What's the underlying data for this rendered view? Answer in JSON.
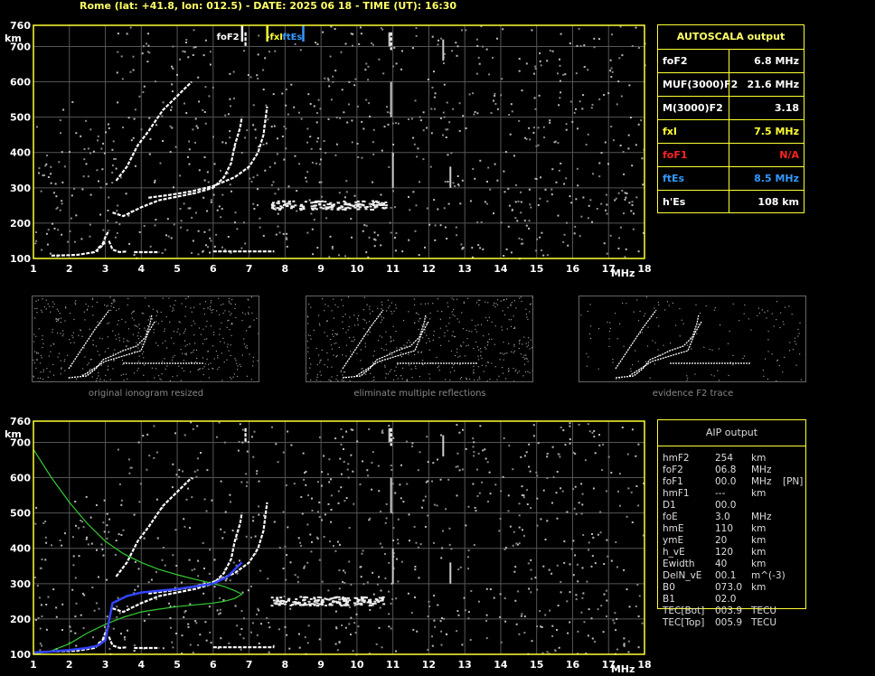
{
  "header": "Rome (lat: +41.8, lon: 012.5) - DATE: 2025 06 18 - TIME (UT): 16:30",
  "axes": {
    "y_ticks": [
      "760",
      "700",
      "600",
      "500",
      "400",
      "300",
      "200",
      "100"
    ],
    "y_unit": "km",
    "x_ticks": [
      "1",
      "2",
      "3",
      "4",
      "5",
      "6",
      "7",
      "8",
      "9",
      "10",
      "11",
      "12",
      "13",
      "14",
      "15",
      "16",
      "17",
      "18"
    ],
    "x_unit": "MHz"
  },
  "markers": {
    "foF2": "foF2",
    "fxI": "fxI",
    "ftEs": "ftEs",
    "foF2_color": "#ffffff",
    "fxI_color": "#ffff33",
    "ftEs_color": "#3399ff"
  },
  "autoscala": {
    "title": "AUTOSCALA output",
    "rows": [
      {
        "label": "foF2",
        "value": "6.8 MHz",
        "color": "#ffffff"
      },
      {
        "label": "MUF(3000)F2",
        "value": "21.6 MHz",
        "color": "#ffffff"
      },
      {
        "label": "M(3000)F2",
        "value": "3.18",
        "color": "#ffffff"
      },
      {
        "label": "fxI",
        "value": "7.5 MHz",
        "color": "#ffff33"
      },
      {
        "label": "foF1",
        "value": "N/A",
        "color": "#ff2222"
      },
      {
        "label": "ftEs",
        "value": "8.5 MHz",
        "color": "#3399ff"
      },
      {
        "label": "h'Es",
        "value": "108    km",
        "color": "#ffffff"
      }
    ]
  },
  "thumbnails": [
    {
      "caption": "original ionogram resized"
    },
    {
      "caption": "eliminate multiple reflections"
    },
    {
      "caption": "evidence F2 trace"
    }
  ],
  "aip": {
    "title": "AIP output",
    "rows": [
      [
        "hmF2",
        "254",
        "km",
        ""
      ],
      [
        "foF2",
        "06.8",
        "MHz",
        ""
      ],
      [
        "foF1",
        "00.0",
        "MHz",
        "[PN]"
      ],
      [
        "hmF1",
        "---",
        "km",
        ""
      ],
      [
        "D1",
        "00.0",
        "",
        ""
      ],
      [
        "foE",
        "3.0",
        "MHz",
        ""
      ],
      [
        "hmE",
        "110",
        "km",
        ""
      ],
      [
        "ymE",
        "20",
        "km",
        ""
      ],
      [
        "h_vE",
        "120",
        "km",
        ""
      ],
      [
        "Ewidth",
        "40",
        "km",
        ""
      ],
      [
        "DelN_vE",
        "00.1",
        "m^(-3)",
        ""
      ],
      [
        "B0",
        "073.0",
        "km",
        ""
      ],
      [
        "B1",
        "02.0",
        "",
        ""
      ],
      [
        "TEC[Bot]",
        "003.9",
        "TECU",
        ""
      ],
      [
        "TEC[Top]",
        "005.9",
        "TECU",
        ""
      ]
    ]
  },
  "chart_data": [
    {
      "type": "scatter",
      "title": "",
      "xlabel": "MHz",
      "ylabel": "km",
      "xlim": [
        1,
        18
      ],
      "ylim": [
        100,
        760
      ],
      "grid": true,
      "series": [
        {
          "name": "foF2",
          "color": "#ffffff",
          "x": [
            3.6,
            3.8,
            4.0,
            4.5,
            5.0,
            5.5,
            6.0,
            6.3,
            6.5,
            6.6,
            6.7,
            6.8
          ],
          "values": [
            255,
            262,
            270,
            278,
            286,
            300,
            325,
            350,
            380,
            420,
            470,
            500
          ]
        },
        {
          "name": "fxI",
          "color": "#ffffff",
          "x": [
            4.2,
            4.8,
            5.4,
            6.0,
            6.6,
            7.0,
            7.2,
            7.35,
            7.45,
            7.5
          ],
          "values": [
            270,
            278,
            285,
            300,
            320,
            350,
            390,
            440,
            500,
            550
          ]
        },
        {
          "name": "ftEs",
          "color": "#ffffff",
          "x": [
            7.5,
            8.0,
            8.5,
            9.0,
            9.5,
            10.0,
            10.5,
            10.7
          ],
          "values": [
            245,
            250,
            255,
            250,
            255,
            250,
            255,
            250
          ]
        }
      ]
    },
    {
      "type": "line",
      "title": "",
      "xlabel": "MHz",
      "ylabel": "km",
      "xlim": [
        1,
        18
      ],
      "ylim": [
        100,
        760
      ],
      "grid": true,
      "series": [
        {
          "name": "hmF2",
          "color": "#33cc33",
          "x": [
            1.0,
            1.5,
            2.0,
            2.5,
            3.0,
            3.5,
            4.0,
            4.5,
            5.0,
            5.5,
            6.0,
            6.3,
            6.6,
            6.8,
            6.6,
            6.3,
            6.0,
            5.5,
            5.0,
            4.5,
            4.0,
            3.5,
            3.0,
            2.5,
            2.0,
            1.5,
            1.0
          ],
          "values": [
            680,
            600,
            530,
            470,
            420,
            385,
            360,
            340,
            325,
            312,
            300,
            292,
            280,
            270,
            258,
            250,
            245,
            240,
            235,
            228,
            220,
            205,
            185,
            160,
            130,
            110,
            100
          ]
        },
        {
          "name": "foF2",
          "color": "#3344ff",
          "x": [
            1.0,
            1.5,
            2.0,
            2.5,
            2.8,
            3.0,
            3.2,
            3.6,
            4.0,
            4.5,
            5.0,
            5.5,
            6.0,
            6.4,
            6.8
          ],
          "values": [
            105,
            108,
            112,
            118,
            125,
            140,
            245,
            265,
            275,
            280,
            285,
            292,
            300,
            320,
            360
          ]
        }
      ]
    }
  ]
}
